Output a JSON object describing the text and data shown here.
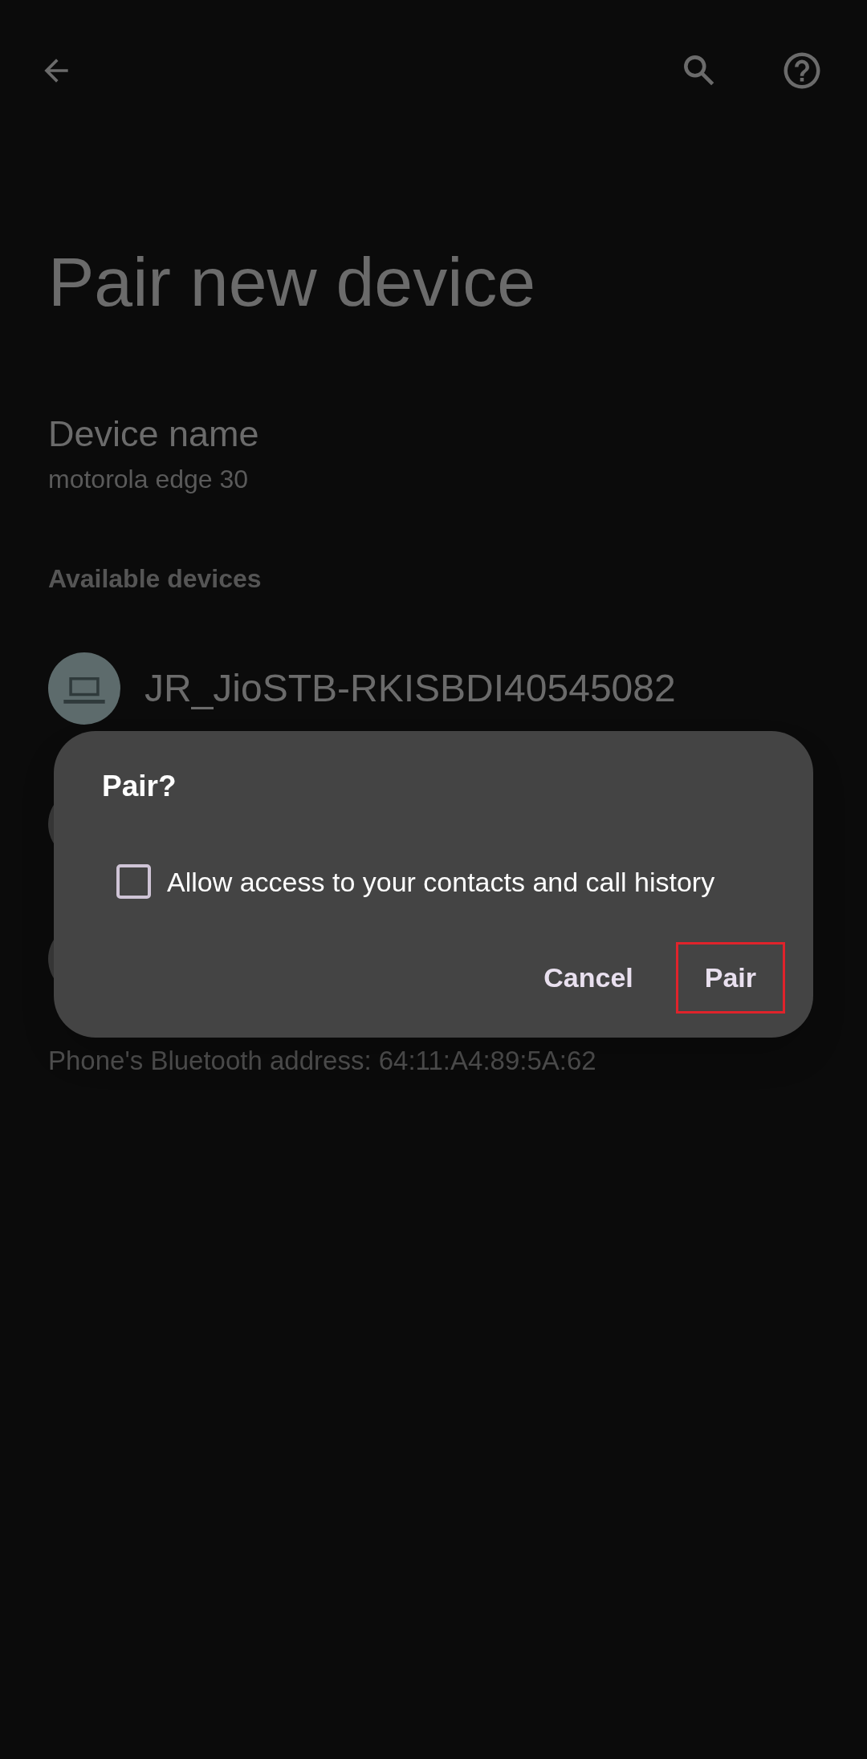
{
  "title": "Pair new device",
  "device_name": {
    "label": "Device name",
    "value": "motorola edge 30"
  },
  "section": "Available devices",
  "devices": [
    {
      "name": "JR_JioSTB-RKISBDI40545082"
    }
  ],
  "footer": "Phone's Bluetooth address: 64:11:A4:89:5A:62",
  "dialog": {
    "title": "Pair?",
    "option": {
      "label": "Allow access to your contacts and call history",
      "checked": false
    },
    "buttons": [
      {
        "label": "Cancel",
        "highlighted": false
      },
      {
        "label": "Pair",
        "highlighted": true
      }
    ]
  }
}
